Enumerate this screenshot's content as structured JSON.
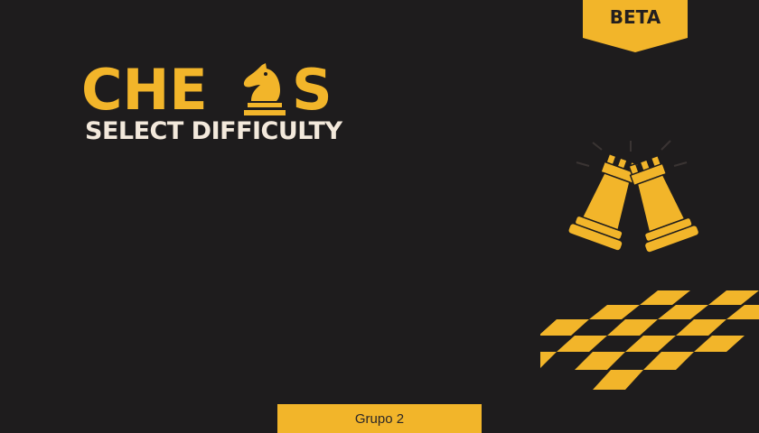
{
  "colors": {
    "background": "#1e1c1d",
    "accent": "#f2b52a",
    "title_text": "#f3e9dc",
    "dark_text": "#231f20"
  },
  "badge": {
    "label": "BETA"
  },
  "logo": {
    "letters_before": "CHE",
    "knight_icon": "chess-knight-icon",
    "letters_after": "S"
  },
  "screen": {
    "subtitle": "SELECT DIFFICULTY"
  },
  "illustrations": {
    "rooks_icon": "crossed-rooks-icon",
    "board_icon": "checkerboard-icon"
  },
  "footer": {
    "label": "Grupo 2"
  }
}
